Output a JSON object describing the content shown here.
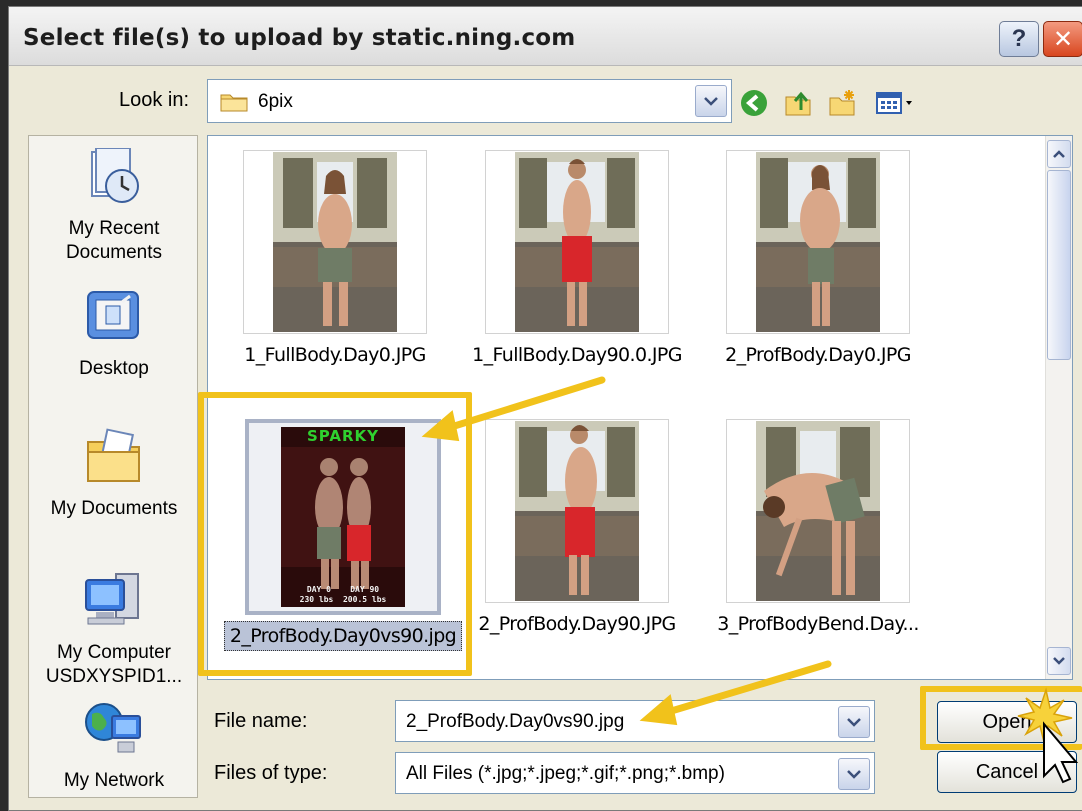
{
  "window": {
    "title": "Select file(s) to upload by static.ning.com",
    "help_glyph": "?",
    "close_glyph": "✕"
  },
  "lookin": {
    "label": "Look in:",
    "value": "6pix"
  },
  "places": [
    {
      "label_lines": [
        "My Recent",
        "Documents"
      ],
      "icon": "recent-documents-icon"
    },
    {
      "label_lines": [
        "Desktop"
      ],
      "icon": "desktop-icon"
    },
    {
      "label_lines": [
        "My Documents"
      ],
      "icon": "my-documents-icon"
    },
    {
      "label_lines": [
        "My Computer",
        "USDXYSPID1..."
      ],
      "icon": "my-computer-icon"
    },
    {
      "label_lines": [
        "My Network"
      ],
      "icon": "my-network-icon"
    }
  ],
  "files": [
    {
      "name": "1_FullBody.Day0.JPG"
    },
    {
      "name": "1_FullBody.Day90.0.JPG"
    },
    {
      "name": "2_ProfBody.Day0.JPG"
    },
    {
      "name": "2_ProfBody.Day0vs90.jpg",
      "selected": true,
      "overlay_title": "SPARKY",
      "overlay_caption": [
        "DAY 0    DAY 90",
        "230 lbs  200.5 lbs"
      ]
    },
    {
      "name": "2_ProfBody.Day90.JPG"
    },
    {
      "name": "3_ProfBodyBend.Day..."
    }
  ],
  "file_name": {
    "label": "File name:",
    "value": "2_ProfBody.Day0vs90.jpg"
  },
  "files_of_type": {
    "label": "Files of type:",
    "value": "All Files (*.jpg;*.jpeg;*.gif;*.png;*.bmp)"
  },
  "buttons": {
    "open": "Open",
    "cancel": "Cancel"
  },
  "colors": {
    "annotation": "#f1c21b",
    "selection": "#bac3d7",
    "dialog_bg": "#ece9d8"
  }
}
